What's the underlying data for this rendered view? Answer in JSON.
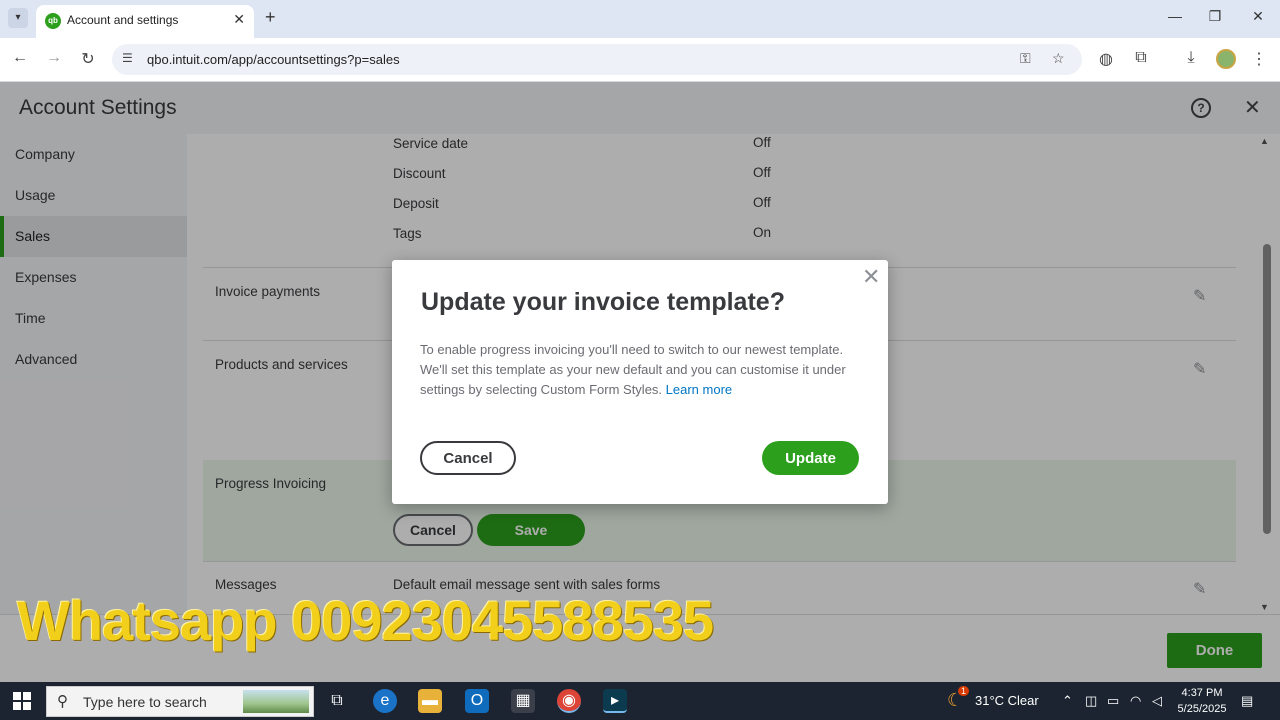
{
  "browser": {
    "tab_title": "Account and settings",
    "url": "qbo.intuit.com/app/accountsettings?p=sales",
    "tab_favicon_text": "qb"
  },
  "header": {
    "title": "Account Settings"
  },
  "sidebar": {
    "items": [
      {
        "label": "Company"
      },
      {
        "label": "Usage"
      },
      {
        "label": "Sales"
      },
      {
        "label": "Expenses"
      },
      {
        "label": "Time"
      },
      {
        "label": "Advanced"
      }
    ],
    "active": "Sales"
  },
  "content": {
    "fields": [
      {
        "label": "Service date",
        "value": "Off"
      },
      {
        "label": "Discount",
        "value": "Off"
      },
      {
        "label": "Deposit",
        "value": "Off"
      },
      {
        "label": "Tags",
        "value": "On"
      }
    ],
    "sections": {
      "invoice_payments": "Invoice payments",
      "products_services": "Products and services",
      "progress_invoicing": "Progress Invoicing",
      "messages": "Messages",
      "messages_desc": "Default email message sent with sales forms"
    },
    "cancel_label": "Cancel",
    "save_label": "Save"
  },
  "footer": {
    "done_label": "Done"
  },
  "modal": {
    "title": "Update your invoice template?",
    "body": "To enable progress invoicing you'll need to switch to our newest template. We'll set this template as your new default and you can customise it under settings by selecting Custom Form Styles.",
    "link": "Learn more",
    "cancel_label": "Cancel",
    "update_label": "Update"
  },
  "watermark": "Whatsapp 00923045588535",
  "taskbar": {
    "search_placeholder": "Type here to search",
    "weather": "31°C  Clear",
    "weather_badge": "1",
    "time": "4:37 PM",
    "date": "5/25/2025"
  },
  "colors": {
    "brand_green": "#2ca01c",
    "link_blue": "#0077c5"
  }
}
